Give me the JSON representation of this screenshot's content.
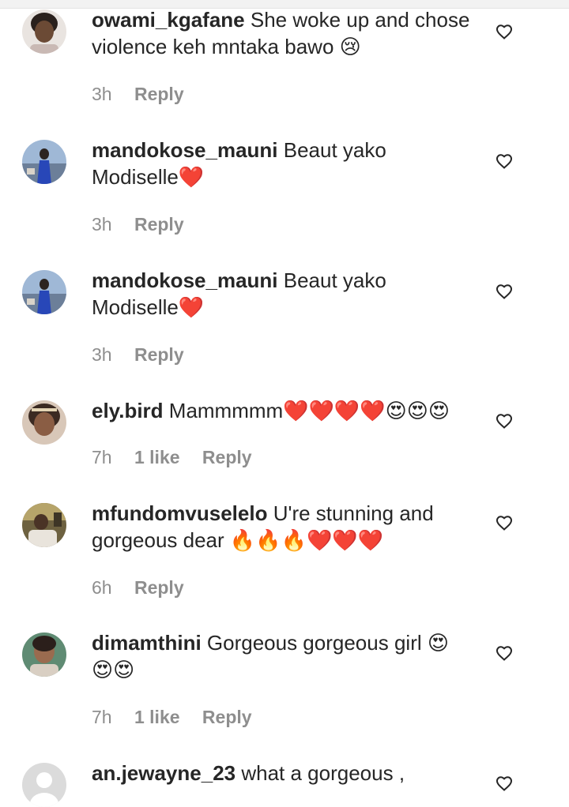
{
  "comments": [
    {
      "username": "owami_kgafane",
      "text": "She woke up and chose violence keh mntaka bawo 😢",
      "time": "3h",
      "likes": "",
      "reply": "Reply"
    },
    {
      "username": "mandokose_mauni",
      "text": "Beaut yako Modiselle❤️",
      "time": "3h",
      "likes": "",
      "reply": "Reply"
    },
    {
      "username": "mandokose_mauni",
      "text": "Beaut yako Modiselle❤️",
      "time": "3h",
      "likes": "",
      "reply": "Reply"
    },
    {
      "username": "ely.bird",
      "text": "Mammmmm❤️❤️❤️❤️😍😍😍",
      "time": "7h",
      "likes": "1 like",
      "reply": "Reply"
    },
    {
      "username": "mfundomvuselelo",
      "text": "U're stunning and gorgeous dear 🔥🔥🔥❤️❤️❤️",
      "time": "6h",
      "likes": "",
      "reply": "Reply"
    },
    {
      "username": "dimamthini",
      "text": "Gorgeous gorgeous girl 😍 😍😍",
      "time": "7h",
      "likes": "1 like",
      "reply": "Reply"
    },
    {
      "username": "an.jewayne_23",
      "text": "what a gorgeous ,",
      "time": "",
      "likes": "",
      "reply": ""
    }
  ],
  "icons": {
    "like": "heart-outline-icon",
    "avatar_placeholder": "default-avatar-icon"
  },
  "colors": {
    "text": "#262626",
    "meta": "#8e8e8e",
    "background": "#ffffff"
  }
}
